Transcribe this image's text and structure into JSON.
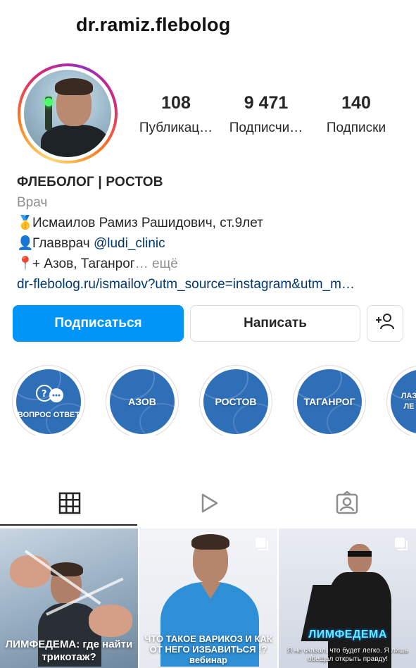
{
  "profile": {
    "username": "dr.ramiz.flebolog",
    "stats": {
      "posts_count": "108",
      "posts_label": "Публикац…",
      "followers_count": "9 471",
      "followers_label": "Подписчи…",
      "following_count": "140",
      "following_label": "Подписки"
    },
    "bio": {
      "name": "ФЛЕБОЛОГ | РОСТОВ",
      "category": "Врач",
      "line1_emoji": "🥇",
      "line1": "Исмаилов Рамиз Рашидович, ст.9лет",
      "line2_emoji": "👤",
      "line2": "Главврач ",
      "line2_mention": "@ludi_clinic",
      "line3_emoji": "📍",
      "line3": "+ Азов, Таганрог",
      "more": "… ещё",
      "link": "dr-flebolog.ru/ismailov?utm_source=instagram&utm_m…"
    },
    "buttons": {
      "follow": "Подписаться",
      "message": "Написать"
    },
    "highlights": [
      {
        "label": "ВОПРОС ОТВЕТ"
      },
      {
        "label": "АЗОВ"
      },
      {
        "label": "РОСТОВ"
      },
      {
        "label": "ТАГАНРОГ"
      },
      {
        "label": "ЛАЗ ЛЕ"
      }
    ],
    "tabs": {
      "active": "grid"
    },
    "posts": [
      {
        "caption": "ЛИМФЕДЕМА: где найти трикотаж?"
      },
      {
        "caption": "ЧТО ТАКОЕ ВАРИКОЗ И КАК ОТ НЕГО ИЗБАВИТЬСЯ !? вебинар"
      },
      {
        "title": "ЛИМФЕДЕМА",
        "sub": "Я не сказал, что будет легко. Я лишь обещал открыть правду!"
      }
    ]
  },
  "colors": {
    "accent": "#0095f6",
    "link": "#00376b",
    "highlight_bg": "#2f6fb8",
    "muted": "#8e8e8e"
  },
  "icons": [
    "grid-icon",
    "reels-icon",
    "tagged-icon",
    "add-user-icon",
    "multi-post-icon"
  ]
}
